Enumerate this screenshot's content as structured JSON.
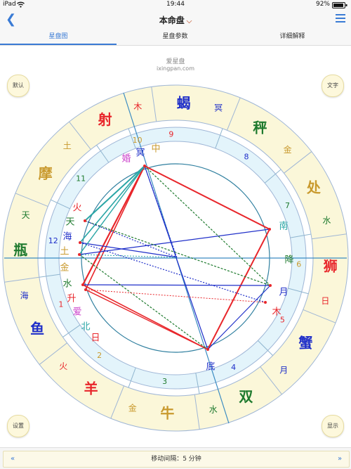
{
  "status_bar": {
    "device": "iPad",
    "time": "19:44",
    "battery": "92%"
  },
  "nav": {
    "title": "本命盘",
    "back_icon": "chevron-left-icon",
    "menu_icon": "hamburger-menu-icon"
  },
  "tabs": [
    {
      "label": "星盘图",
      "active": true
    },
    {
      "label": "星盘参数",
      "active": false
    },
    {
      "label": "详细解释",
      "active": false
    }
  ],
  "credit": {
    "name": "爱星盘",
    "url": "ixingpan.com"
  },
  "corner_buttons": {
    "top_left": "默认",
    "top_right": "文字",
    "bottom_left": "设置",
    "bottom_right": "显示"
  },
  "bottom": {
    "prev": "«",
    "next": "»",
    "interval_label": "移动间隔：5 分钟"
  },
  "colors": {
    "zodiac_band": "#fbf7d9",
    "house_band": "#e3f4fb",
    "red": "#e8262b",
    "blue": "#1f2fc9",
    "green": "#1e7a2e",
    "teal": "#2aa6a6",
    "gold": "#c99a2e"
  },
  "zodiac_signs": [
    {
      "sign": "蝎",
      "ruler": "冥",
      "sign_color": "#1f2fc9",
      "ruler_color": "#1f2fc9"
    },
    {
      "sign": "秤",
      "ruler": "金",
      "sign_color": "#1e7a2e",
      "ruler_color": "#c99a2e"
    },
    {
      "sign": "处",
      "ruler": "水",
      "sign_color": "#c99a2e",
      "ruler_color": "#1e7a2e"
    },
    {
      "sign": "狮",
      "ruler": "日",
      "sign_color": "#e8262b",
      "ruler_color": "#e8262b"
    },
    {
      "sign": "蟹",
      "ruler": "月",
      "sign_color": "#1f2fc9",
      "ruler_color": "#1f2fc9"
    },
    {
      "sign": "双",
      "ruler": "水",
      "sign_color": "#1e7a2e",
      "ruler_color": "#1e7a2e"
    },
    {
      "sign": "牛",
      "ruler": "金",
      "sign_color": "#c99a2e",
      "ruler_color": "#c99a2e"
    },
    {
      "sign": "羊",
      "ruler": "火",
      "sign_color": "#e8262b",
      "ruler_color": "#e8262b"
    },
    {
      "sign": "鱼",
      "ruler": "海",
      "sign_color": "#1f2fc9",
      "ruler_color": "#1f2fc9"
    },
    {
      "sign": "瓶",
      "ruler": "天",
      "sign_color": "#1e7a2e",
      "ruler_color": "#1e7a2e"
    },
    {
      "sign": "摩",
      "ruler": "土",
      "sign_color": "#c99a2e",
      "ruler_color": "#c99a2e"
    },
    {
      "sign": "射",
      "ruler": "木",
      "sign_color": "#e8262b",
      "ruler_color": "#e8262b"
    }
  ],
  "houses": [
    {
      "num": "9",
      "color": "#e8262b"
    },
    {
      "num": "8",
      "color": "#1f2fc9"
    },
    {
      "num": "7",
      "color": "#1e7a2e"
    },
    {
      "num": "6",
      "color": "#c99a2e"
    },
    {
      "num": "5",
      "color": "#e8262b"
    },
    {
      "num": "4",
      "color": "#1f2fc9"
    },
    {
      "num": "3",
      "color": "#1e7a2e"
    },
    {
      "num": "2",
      "color": "#c99a2e"
    },
    {
      "num": "1",
      "color": "#e8262b"
    },
    {
      "num": "12",
      "color": "#1f2fc9"
    },
    {
      "num": "11",
      "color": "#1e7a2e"
    },
    {
      "num": "10",
      "color": "#c99a2e"
    }
  ],
  "planets": [
    {
      "label": "冥",
      "color": "#1f2fc9"
    },
    {
      "label": "中",
      "color": "#c99a2e"
    },
    {
      "label": "婚",
      "color": "#cc44cc"
    },
    {
      "label": "南",
      "color": "#2aa6a6"
    },
    {
      "label": "降",
      "color": "#1e7a2e"
    },
    {
      "label": "月",
      "color": "#1f2fc9"
    },
    {
      "label": "木",
      "color": "#e8262b"
    },
    {
      "label": "底",
      "color": "#1f2fc9"
    },
    {
      "label": "火",
      "color": "#e8262b"
    },
    {
      "label": "天",
      "color": "#1e7a2e"
    },
    {
      "label": "海",
      "color": "#1f2fc9"
    },
    {
      "label": "土",
      "color": "#c99a2e"
    },
    {
      "label": "金",
      "color": "#c99a2e"
    },
    {
      "label": "水",
      "color": "#1e7a2e"
    },
    {
      "label": "升",
      "color": "#e8262b"
    },
    {
      "label": "爱",
      "color": "#cc44cc"
    },
    {
      "label": "北",
      "color": "#2aa6a6"
    },
    {
      "label": "日",
      "color": "#e8262b"
    }
  ]
}
